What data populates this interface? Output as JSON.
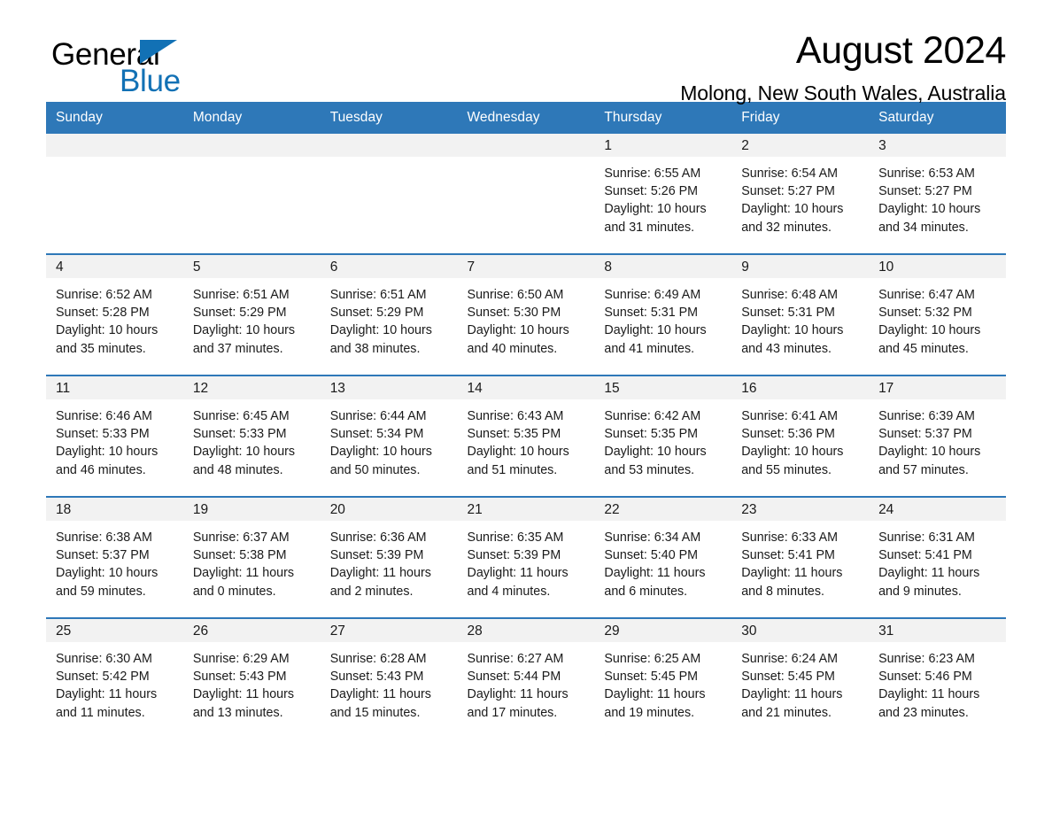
{
  "brand": {
    "name_part1": "General",
    "name_part2": "Blue",
    "accent_color": "#1271b5",
    "triangle_icon": "brand-triangle-icon"
  },
  "header": {
    "title": "August 2024",
    "subtitle": "Molong, New South Wales, Australia"
  },
  "calendar": {
    "header_bg": "#2e78b8",
    "daynum_bg": "#f2f2f2",
    "weekdays": [
      "Sunday",
      "Monday",
      "Tuesday",
      "Wednesday",
      "Thursday",
      "Friday",
      "Saturday"
    ],
    "weeks": [
      [
        {
          "day": "",
          "lines": []
        },
        {
          "day": "",
          "lines": []
        },
        {
          "day": "",
          "lines": []
        },
        {
          "day": "",
          "lines": []
        },
        {
          "day": "1",
          "lines": [
            "Sunrise: 6:55 AM",
            "Sunset: 5:26 PM",
            "Daylight: 10 hours",
            "and 31 minutes."
          ]
        },
        {
          "day": "2",
          "lines": [
            "Sunrise: 6:54 AM",
            "Sunset: 5:27 PM",
            "Daylight: 10 hours",
            "and 32 minutes."
          ]
        },
        {
          "day": "3",
          "lines": [
            "Sunrise: 6:53 AM",
            "Sunset: 5:27 PM",
            "Daylight: 10 hours",
            "and 34 minutes."
          ]
        }
      ],
      [
        {
          "day": "4",
          "lines": [
            "Sunrise: 6:52 AM",
            "Sunset: 5:28 PM",
            "Daylight: 10 hours",
            "and 35 minutes."
          ]
        },
        {
          "day": "5",
          "lines": [
            "Sunrise: 6:51 AM",
            "Sunset: 5:29 PM",
            "Daylight: 10 hours",
            "and 37 minutes."
          ]
        },
        {
          "day": "6",
          "lines": [
            "Sunrise: 6:51 AM",
            "Sunset: 5:29 PM",
            "Daylight: 10 hours",
            "and 38 minutes."
          ]
        },
        {
          "day": "7",
          "lines": [
            "Sunrise: 6:50 AM",
            "Sunset: 5:30 PM",
            "Daylight: 10 hours",
            "and 40 minutes."
          ]
        },
        {
          "day": "8",
          "lines": [
            "Sunrise: 6:49 AM",
            "Sunset: 5:31 PM",
            "Daylight: 10 hours",
            "and 41 minutes."
          ]
        },
        {
          "day": "9",
          "lines": [
            "Sunrise: 6:48 AM",
            "Sunset: 5:31 PM",
            "Daylight: 10 hours",
            "and 43 minutes."
          ]
        },
        {
          "day": "10",
          "lines": [
            "Sunrise: 6:47 AM",
            "Sunset: 5:32 PM",
            "Daylight: 10 hours",
            "and 45 minutes."
          ]
        }
      ],
      [
        {
          "day": "11",
          "lines": [
            "Sunrise: 6:46 AM",
            "Sunset: 5:33 PM",
            "Daylight: 10 hours",
            "and 46 minutes."
          ]
        },
        {
          "day": "12",
          "lines": [
            "Sunrise: 6:45 AM",
            "Sunset: 5:33 PM",
            "Daylight: 10 hours",
            "and 48 minutes."
          ]
        },
        {
          "day": "13",
          "lines": [
            "Sunrise: 6:44 AM",
            "Sunset: 5:34 PM",
            "Daylight: 10 hours",
            "and 50 minutes."
          ]
        },
        {
          "day": "14",
          "lines": [
            "Sunrise: 6:43 AM",
            "Sunset: 5:35 PM",
            "Daylight: 10 hours",
            "and 51 minutes."
          ]
        },
        {
          "day": "15",
          "lines": [
            "Sunrise: 6:42 AM",
            "Sunset: 5:35 PM",
            "Daylight: 10 hours",
            "and 53 minutes."
          ]
        },
        {
          "day": "16",
          "lines": [
            "Sunrise: 6:41 AM",
            "Sunset: 5:36 PM",
            "Daylight: 10 hours",
            "and 55 minutes."
          ]
        },
        {
          "day": "17",
          "lines": [
            "Sunrise: 6:39 AM",
            "Sunset: 5:37 PM",
            "Daylight: 10 hours",
            "and 57 minutes."
          ]
        }
      ],
      [
        {
          "day": "18",
          "lines": [
            "Sunrise: 6:38 AM",
            "Sunset: 5:37 PM",
            "Daylight: 10 hours",
            "and 59 minutes."
          ]
        },
        {
          "day": "19",
          "lines": [
            "Sunrise: 6:37 AM",
            "Sunset: 5:38 PM",
            "Daylight: 11 hours",
            "and 0 minutes."
          ]
        },
        {
          "day": "20",
          "lines": [
            "Sunrise: 6:36 AM",
            "Sunset: 5:39 PM",
            "Daylight: 11 hours",
            "and 2 minutes."
          ]
        },
        {
          "day": "21",
          "lines": [
            "Sunrise: 6:35 AM",
            "Sunset: 5:39 PM",
            "Daylight: 11 hours",
            "and 4 minutes."
          ]
        },
        {
          "day": "22",
          "lines": [
            "Sunrise: 6:34 AM",
            "Sunset: 5:40 PM",
            "Daylight: 11 hours",
            "and 6 minutes."
          ]
        },
        {
          "day": "23",
          "lines": [
            "Sunrise: 6:33 AM",
            "Sunset: 5:41 PM",
            "Daylight: 11 hours",
            "and 8 minutes."
          ]
        },
        {
          "day": "24",
          "lines": [
            "Sunrise: 6:31 AM",
            "Sunset: 5:41 PM",
            "Daylight: 11 hours",
            "and 9 minutes."
          ]
        }
      ],
      [
        {
          "day": "25",
          "lines": [
            "Sunrise: 6:30 AM",
            "Sunset: 5:42 PM",
            "Daylight: 11 hours",
            "and 11 minutes."
          ]
        },
        {
          "day": "26",
          "lines": [
            "Sunrise: 6:29 AM",
            "Sunset: 5:43 PM",
            "Daylight: 11 hours",
            "and 13 minutes."
          ]
        },
        {
          "day": "27",
          "lines": [
            "Sunrise: 6:28 AM",
            "Sunset: 5:43 PM",
            "Daylight: 11 hours",
            "and 15 minutes."
          ]
        },
        {
          "day": "28",
          "lines": [
            "Sunrise: 6:27 AM",
            "Sunset: 5:44 PM",
            "Daylight: 11 hours",
            "and 17 minutes."
          ]
        },
        {
          "day": "29",
          "lines": [
            "Sunrise: 6:25 AM",
            "Sunset: 5:45 PM",
            "Daylight: 11 hours",
            "and 19 minutes."
          ]
        },
        {
          "day": "30",
          "lines": [
            "Sunrise: 6:24 AM",
            "Sunset: 5:45 PM",
            "Daylight: 11 hours",
            "and 21 minutes."
          ]
        },
        {
          "day": "31",
          "lines": [
            "Sunrise: 6:23 AM",
            "Sunset: 5:46 PM",
            "Daylight: 11 hours",
            "and 23 minutes."
          ]
        }
      ]
    ]
  }
}
